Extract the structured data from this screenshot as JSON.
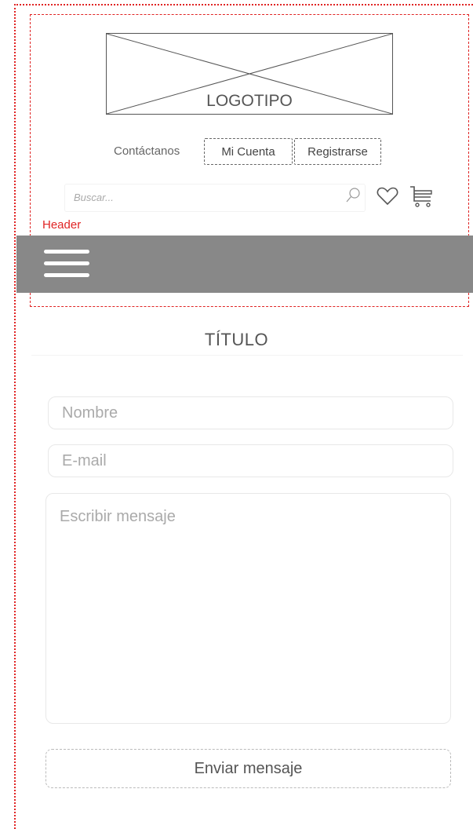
{
  "guides": {
    "header_tag": "Header"
  },
  "header": {
    "logo_text": "LOGOTIPO",
    "links": {
      "contact": "Contáctanos",
      "account": "Mi Cuenta",
      "register": "Registrarse"
    },
    "search": {
      "placeholder": "Buscar..."
    },
    "icons": [
      "search-icon",
      "heart-icon",
      "cart-icon"
    ]
  },
  "nav": {
    "menu_icon": "hamburger-menu-icon"
  },
  "main": {
    "title": "TÍTULO",
    "form": {
      "name_placeholder": "Nombre",
      "email_placeholder": "E-mail",
      "message_placeholder": "Escribir mensaje",
      "submit_label": "Enviar mensaje"
    }
  },
  "colors": {
    "guide_red": "#e02424",
    "navbar_gray": "#888888",
    "text_gray": "#555555"
  }
}
